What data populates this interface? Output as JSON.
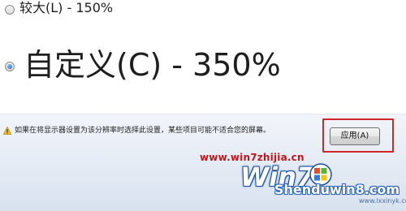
{
  "options": [
    {
      "label": "较大(L) - 150%",
      "selected": false
    },
    {
      "label": "自定义(C) - 350%",
      "selected": true
    }
  ],
  "footer": {
    "warning_icon": "warning-icon",
    "warning_text": "如果在将显示器设置为该分辨率时选择此设置，某些项目可能不适合您的屏幕。",
    "apply_label": "应用(A)",
    "highlight_color": "#d2262c"
  },
  "watermark": {
    "url": "www.win7zhijia.cn",
    "logo_text": "Win7",
    "site": "Shenduwin8.com",
    "site_small": "www.lxxinyk.com"
  }
}
